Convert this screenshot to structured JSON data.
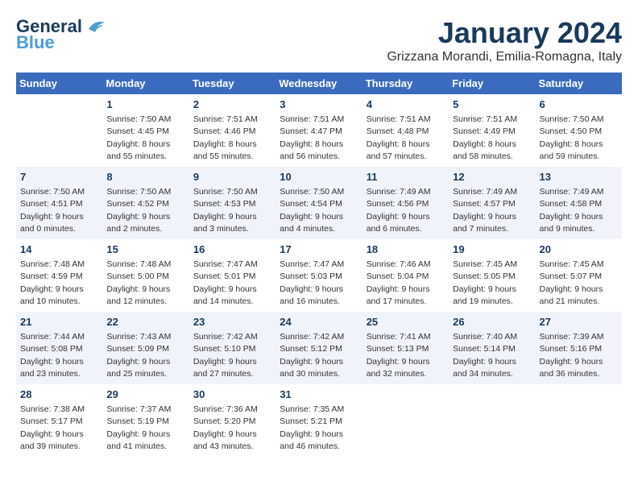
{
  "header": {
    "logo_general": "General",
    "logo_blue": "Blue",
    "month_title": "January 2024",
    "subtitle": "Grizzana Morandi, Emilia-Romagna, Italy"
  },
  "weekdays": [
    "Sunday",
    "Monday",
    "Tuesday",
    "Wednesday",
    "Thursday",
    "Friday",
    "Saturday"
  ],
  "weeks": [
    [
      {
        "day": "",
        "info": ""
      },
      {
        "day": "1",
        "info": "Sunrise: 7:50 AM\nSunset: 4:45 PM\nDaylight: 8 hours\nand 55 minutes."
      },
      {
        "day": "2",
        "info": "Sunrise: 7:51 AM\nSunset: 4:46 PM\nDaylight: 8 hours\nand 55 minutes."
      },
      {
        "day": "3",
        "info": "Sunrise: 7:51 AM\nSunset: 4:47 PM\nDaylight: 8 hours\nand 56 minutes."
      },
      {
        "day": "4",
        "info": "Sunrise: 7:51 AM\nSunset: 4:48 PM\nDaylight: 8 hours\nand 57 minutes."
      },
      {
        "day": "5",
        "info": "Sunrise: 7:51 AM\nSunset: 4:49 PM\nDaylight: 8 hours\nand 58 minutes."
      },
      {
        "day": "6",
        "info": "Sunrise: 7:50 AM\nSunset: 4:50 PM\nDaylight: 8 hours\nand 59 minutes."
      }
    ],
    [
      {
        "day": "7",
        "info": "Sunrise: 7:50 AM\nSunset: 4:51 PM\nDaylight: 9 hours\nand 0 minutes."
      },
      {
        "day": "8",
        "info": "Sunrise: 7:50 AM\nSunset: 4:52 PM\nDaylight: 9 hours\nand 2 minutes."
      },
      {
        "day": "9",
        "info": "Sunrise: 7:50 AM\nSunset: 4:53 PM\nDaylight: 9 hours\nand 3 minutes."
      },
      {
        "day": "10",
        "info": "Sunrise: 7:50 AM\nSunset: 4:54 PM\nDaylight: 9 hours\nand 4 minutes."
      },
      {
        "day": "11",
        "info": "Sunrise: 7:49 AM\nSunset: 4:56 PM\nDaylight: 9 hours\nand 6 minutes."
      },
      {
        "day": "12",
        "info": "Sunrise: 7:49 AM\nSunset: 4:57 PM\nDaylight: 9 hours\nand 7 minutes."
      },
      {
        "day": "13",
        "info": "Sunrise: 7:49 AM\nSunset: 4:58 PM\nDaylight: 9 hours\nand 9 minutes."
      }
    ],
    [
      {
        "day": "14",
        "info": "Sunrise: 7:48 AM\nSunset: 4:59 PM\nDaylight: 9 hours\nand 10 minutes."
      },
      {
        "day": "15",
        "info": "Sunrise: 7:48 AM\nSunset: 5:00 PM\nDaylight: 9 hours\nand 12 minutes."
      },
      {
        "day": "16",
        "info": "Sunrise: 7:47 AM\nSunset: 5:01 PM\nDaylight: 9 hours\nand 14 minutes."
      },
      {
        "day": "17",
        "info": "Sunrise: 7:47 AM\nSunset: 5:03 PM\nDaylight: 9 hours\nand 16 minutes."
      },
      {
        "day": "18",
        "info": "Sunrise: 7:46 AM\nSunset: 5:04 PM\nDaylight: 9 hours\nand 17 minutes."
      },
      {
        "day": "19",
        "info": "Sunrise: 7:45 AM\nSunset: 5:05 PM\nDaylight: 9 hours\nand 19 minutes."
      },
      {
        "day": "20",
        "info": "Sunrise: 7:45 AM\nSunset: 5:07 PM\nDaylight: 9 hours\nand 21 minutes."
      }
    ],
    [
      {
        "day": "21",
        "info": "Sunrise: 7:44 AM\nSunset: 5:08 PM\nDaylight: 9 hours\nand 23 minutes."
      },
      {
        "day": "22",
        "info": "Sunrise: 7:43 AM\nSunset: 5:09 PM\nDaylight: 9 hours\nand 25 minutes."
      },
      {
        "day": "23",
        "info": "Sunrise: 7:42 AM\nSunset: 5:10 PM\nDaylight: 9 hours\nand 27 minutes."
      },
      {
        "day": "24",
        "info": "Sunrise: 7:42 AM\nSunset: 5:12 PM\nDaylight: 9 hours\nand 30 minutes."
      },
      {
        "day": "25",
        "info": "Sunrise: 7:41 AM\nSunset: 5:13 PM\nDaylight: 9 hours\nand 32 minutes."
      },
      {
        "day": "26",
        "info": "Sunrise: 7:40 AM\nSunset: 5:14 PM\nDaylight: 9 hours\nand 34 minutes."
      },
      {
        "day": "27",
        "info": "Sunrise: 7:39 AM\nSunset: 5:16 PM\nDaylight: 9 hours\nand 36 minutes."
      }
    ],
    [
      {
        "day": "28",
        "info": "Sunrise: 7:38 AM\nSunset: 5:17 PM\nDaylight: 9 hours\nand 39 minutes."
      },
      {
        "day": "29",
        "info": "Sunrise: 7:37 AM\nSunset: 5:19 PM\nDaylight: 9 hours\nand 41 minutes."
      },
      {
        "day": "30",
        "info": "Sunrise: 7:36 AM\nSunset: 5:20 PM\nDaylight: 9 hours\nand 43 minutes."
      },
      {
        "day": "31",
        "info": "Sunrise: 7:35 AM\nSunset: 5:21 PM\nDaylight: 9 hours\nand 46 minutes."
      },
      {
        "day": "",
        "info": ""
      },
      {
        "day": "",
        "info": ""
      },
      {
        "day": "",
        "info": ""
      }
    ]
  ]
}
